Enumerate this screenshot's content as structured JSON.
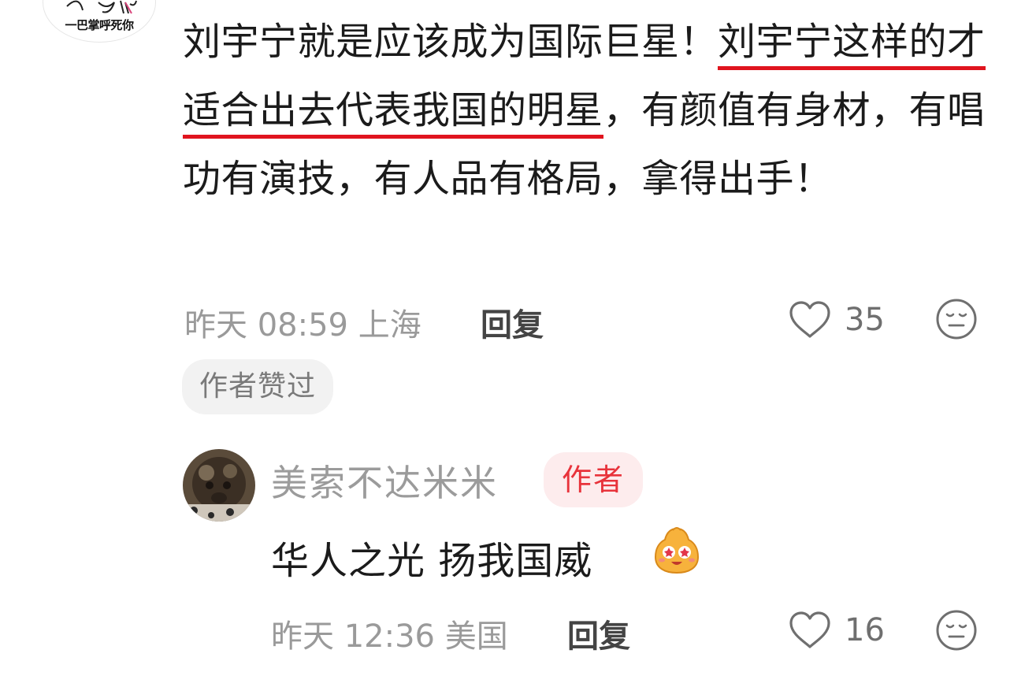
{
  "top_avatar": {
    "caption": "一巴掌呼死你"
  },
  "comment": {
    "segments": [
      {
        "text": "刘宇宁就是应该成为国际巨星！",
        "highlight": false
      },
      {
        "text": "刘宇宁这样的才适合出去代表我国的明星",
        "highlight": true
      },
      {
        "text": "，有颜值有身材，有唱功有演技，有人品有格局，拿得出手！",
        "highlight": false
      }
    ],
    "time": "昨天 08:59",
    "location": "上海",
    "reply_label": "回复",
    "likes": "35",
    "liked_by_author_label": "作者赞过"
  },
  "reply": {
    "username": "美索不达米米",
    "author_badge": "作者",
    "text": "华人之光 扬我国威",
    "emoji": "star-eyes-emoji",
    "time": "昨天 12:36",
    "location": "美国",
    "reply_label": "回复",
    "likes": "16"
  },
  "colors": {
    "highlight_underline": "#e0141e",
    "author_badge_bg": "#fdeced",
    "author_badge_text": "#e8333b",
    "meta_text": "#9a9a9a"
  },
  "icons": [
    "heart-outline-icon",
    "expressionless-face-icon"
  ]
}
